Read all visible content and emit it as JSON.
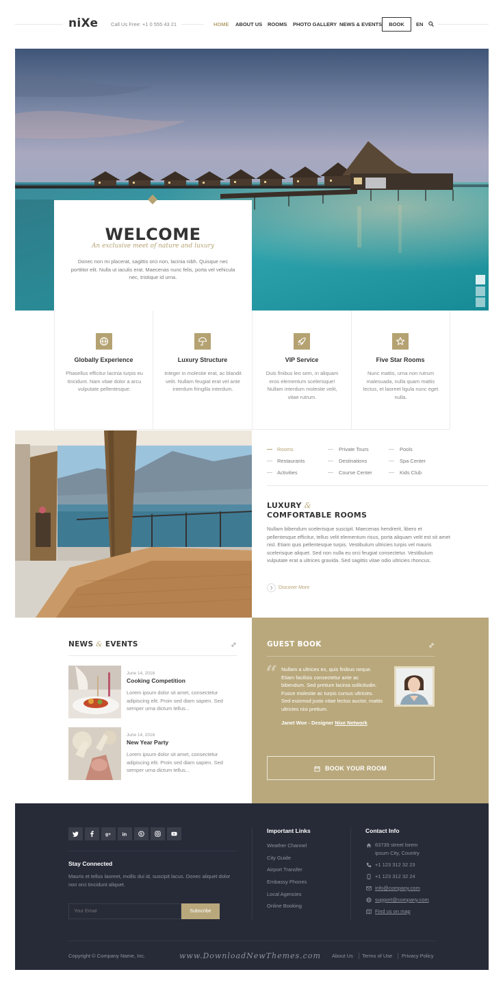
{
  "header": {
    "logo": "niXe",
    "phone": "Call Us Free: +1 0 555 43 21",
    "nav": [
      {
        "label": "HOME",
        "active": true
      },
      {
        "label": "ABOUT US",
        "active": false
      },
      {
        "label": "ROOMS",
        "active": false
      },
      {
        "label": "PHOTO GALLERY",
        "active": false
      },
      {
        "label": "NEWS & EVENTS",
        "active": false
      }
    ],
    "book_label": "BOOK",
    "lang": "EN",
    "search_icon": "search-icon"
  },
  "hero": {
    "title": "WELCOME",
    "subtitle": "An exclusive meet of nature and luxury",
    "text": "Donec non mi placerat, sagittis orci non, lacinia nibh. Quisque nec porttitor elit. Nulla ut iaculis erat. Maecenas nunc felis, porta vel vehicula nec, tristique id urna.",
    "slides_count": 3,
    "active_slide": 1
  },
  "features": [
    {
      "icon": "globe-icon",
      "title": "Globally Experience",
      "text": "Phasellus efficitur lacinia turpis eu tincidunt. Nam vitae dolor a arcu vulputate pellentesque."
    },
    {
      "icon": "umbrella-icon",
      "title": "Luxury Structure",
      "text": "Integer in molestie erat, ac blandit velit. Nullam feugiat erat vel ante interdum fringilla interdum."
    },
    {
      "icon": "rocket-icon",
      "title": "VIP Service",
      "text": "Duis finibus leo sem, in aliquam eros elementum scelerisque! Nullam interdum molestie velit, vitae rutrum."
    },
    {
      "icon": "star-icon",
      "title": "Five Star Rooms",
      "text": "Nunc mattis, urna non rutrum malesuada, nulla quam mattis lectus, et laoreet ligula nunc eget nulla."
    }
  ],
  "rooms": {
    "amenities": [
      [
        "Rooms",
        "Private Tours",
        "Pools"
      ],
      [
        "Restaurants",
        "Destinations",
        "Spa Center"
      ],
      [
        "Activities",
        "Course Center",
        "Kids Club"
      ]
    ],
    "title_line1": "LUXURY",
    "title_amp": "&",
    "title_line2": "COMFORTABLE ROOMS",
    "text": "Nullam bibendum scelerisque suscipit. Maecenas hendrerit, libero et pellentesque efficitur, tellus velit elementum risus, porta aliquam velit est sit amet nisl. Etiam quis pellentesque turpis. Vestibulum ultricies turpis vel mauris scelerisque aliquet. Sed non nulla eu orci feugiat consectetur. Vestibulum vulputate erat a ultrices gravida. Sed sagittis vitae odio ultricies rhoncus.",
    "discover": "Discover More"
  },
  "news": {
    "title_word1": "NEWS",
    "title_amp": "&",
    "title_word2": "EVENTS",
    "items": [
      {
        "date": "June 14, 2016",
        "title": "Cooking Competition",
        "text": "Lorem ipsum dolor sit amet, consectetur adipiscing elit. Proin sed diam sapien. Sed semper urna dictum tellus..."
      },
      {
        "date": "June 14, 2016",
        "title": "New Year Party",
        "text": "Lorem ipsum dolor sit amet, consectetur adipiscing elit. Proin sed diam sapien. Sed semper urna dictum tellus..."
      }
    ]
  },
  "guest": {
    "title": "GUEST BOOK",
    "quote": "Nullam a ultrices ex, quis finibus neque. Etiam facilisis consectetur ante ac bibendum. Sed pretium lacinia sollicitudin. Fusce molestie ac turpis cursus ultricies. Sed euismod justo vitae lectus auctor, mattis ultricies nisi pretium.",
    "author": "Janet Woe - Designer",
    "author_company": "Nixe Network",
    "book_button": "BOOK YOUR ROOM"
  },
  "footer": {
    "social": [
      "twitter-icon",
      "facebook-icon",
      "google-plus-icon",
      "linkedin-icon",
      "skype-icon",
      "instagram-icon",
      "youtube-icon"
    ],
    "stay_title": "Stay Connected",
    "stay_text": "Mauris et tellus laoreet, mollis dui id, suscipit lacus. Donec aliquet dolor non orci tincidunt aliquet.",
    "email_placeholder": "Your Email",
    "subscribe": "Subscribe",
    "links_title": "Important Links",
    "links": [
      "Weather Channel",
      "City Guide",
      "Airport Transfer",
      "Embassy Phones",
      "Local Agencies",
      "Online Booking"
    ],
    "contact_title": "Contact Info",
    "address_line1": "63739 street lorem",
    "address_line2": "ipsum City, Country",
    "phone": "+1 123 312 32 23",
    "mobile": "+1 123 312 32 24",
    "email": "info@company.com",
    "support": "support@company.com",
    "map": "Find us on map",
    "copyright": "Copyright © Company Name, Inc.",
    "watermark": "www.DownloadNewThemes.com",
    "bottom_links": [
      "About Us",
      "Terms of Use",
      "Privacy Policy"
    ]
  },
  "colors": {
    "accent": "#b5a272",
    "guest_bg": "#b9a87c",
    "footer_bg": "#272b38",
    "text_dark": "#333333"
  }
}
